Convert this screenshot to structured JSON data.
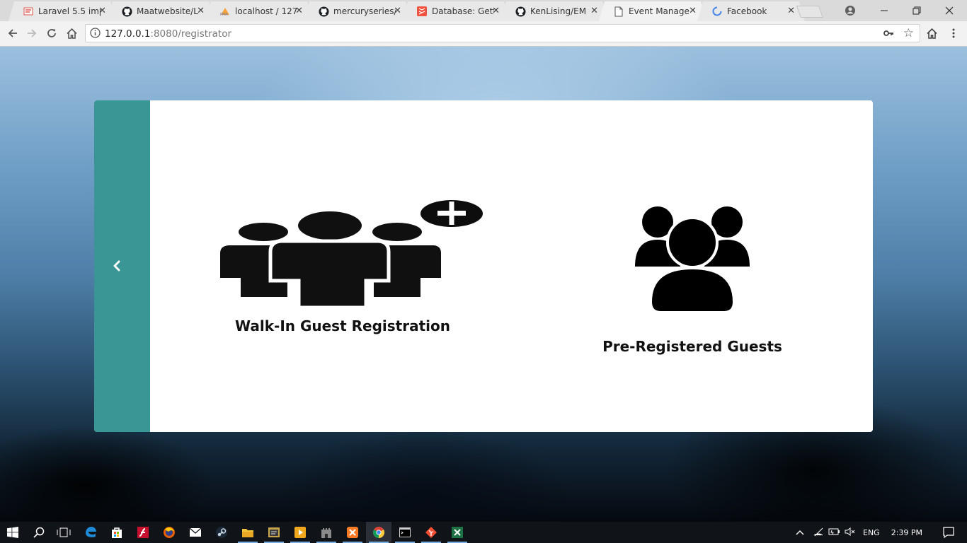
{
  "browser": {
    "tabs": [
      {
        "title": "Laravel 5.5 imp",
        "icon": "laravel-icon",
        "active": false
      },
      {
        "title": "Maatwebsite/L",
        "icon": "github-icon",
        "active": false
      },
      {
        "title": "localhost / 127",
        "icon": "phpmyadmin-icon",
        "active": false
      },
      {
        "title": "mercuryseries/",
        "icon": "github-icon",
        "active": false
      },
      {
        "title": "Database: Gett",
        "icon": "laravel-icon",
        "active": false
      },
      {
        "title": "KenLising/EM",
        "icon": "github-icon",
        "active": false
      },
      {
        "title": "Event Manage",
        "icon": "page-icon",
        "active": true
      },
      {
        "title": "Facebook",
        "icon": "loading-icon",
        "active": false
      }
    ],
    "url": {
      "host": "127.0.0.1",
      "rest": ":8080/registrator"
    }
  },
  "page": {
    "options": [
      {
        "label": "Walk-In Guest Registration",
        "icon": "add-group-icon"
      },
      {
        "label": "Pre-Registered Guests",
        "icon": "group-icon"
      }
    ],
    "accent_color": "#3a9694"
  },
  "taskbar": {
    "language": "ENG",
    "time": "2:39 PM"
  }
}
